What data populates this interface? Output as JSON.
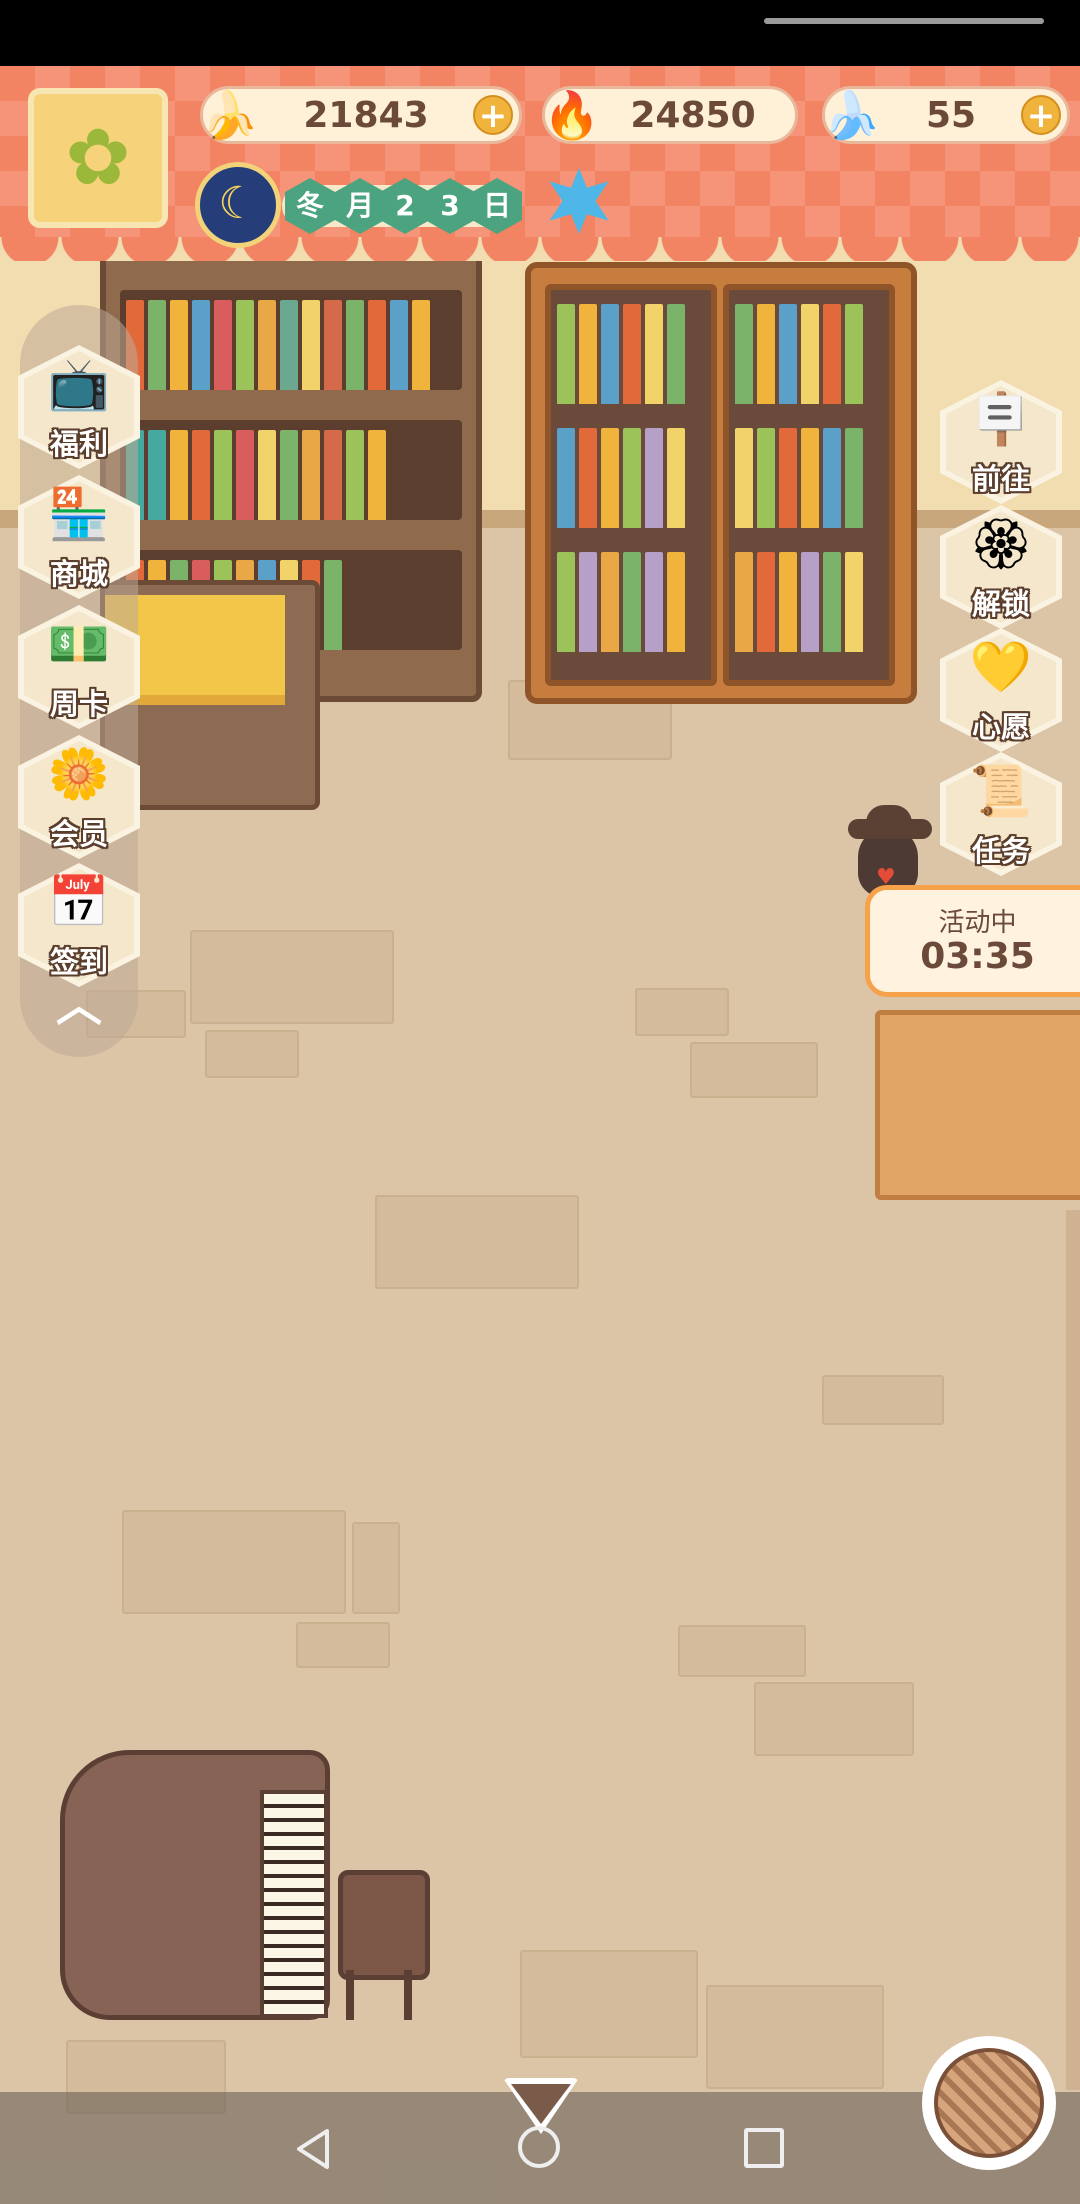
{
  "currencies": {
    "banana": {
      "icon": "banana-icon",
      "value": "21843"
    },
    "flame": {
      "icon": "rainbow-flame-icon",
      "value": "24850"
    },
    "blue_banana": {
      "icon": "blue-banana-icon",
      "value": "55"
    },
    "plus": "+"
  },
  "calendar": {
    "season": "冬",
    "month_label": "月",
    "week": "2",
    "day": "3",
    "day_label": "日"
  },
  "left_menu": [
    {
      "label": "福利",
      "icon": "tv-play-icon"
    },
    {
      "label": "商城",
      "icon": "shop-icon"
    },
    {
      "label": "周卡",
      "icon": "week-card-icon"
    },
    {
      "label": "会员",
      "icon": "member-flower-icon"
    },
    {
      "label": "签到",
      "icon": "signin-calendar-icon"
    }
  ],
  "right_menu": [
    {
      "label": "前往",
      "icon": "signboard-icon"
    },
    {
      "label": "解锁",
      "icon": "unlock-flower-icon"
    },
    {
      "label": "心愿",
      "icon": "wish-heart-book-icon"
    },
    {
      "label": "任务",
      "icon": "task-scroll-icon"
    }
  ],
  "event": {
    "status": "活动中",
    "timer": "03:35"
  },
  "colors": {
    "banner": "#f28463",
    "wall": "#f1ddb0",
    "floor": "#dcc4a6",
    "accent_orange": "#f5a24b"
  }
}
